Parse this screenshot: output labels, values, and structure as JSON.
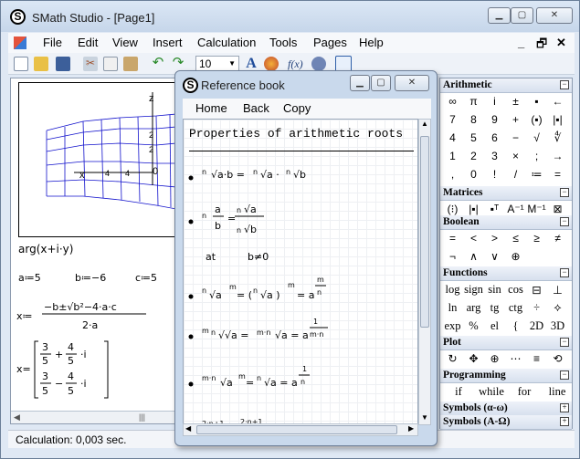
{
  "window": {
    "title": "SMath Studio - [Page1]"
  },
  "menu": [
    "File",
    "Edit",
    "View",
    "Insert",
    "Calculation",
    "Tools",
    "Pages",
    "Help"
  ],
  "toolbar": {
    "font_size": "10"
  },
  "doc": {
    "arg": "arg(x+i·y)",
    "assign": [
      "a≔5",
      "b≔−6",
      "c≔5"
    ],
    "axis_z": "z",
    "axis_x": "x",
    "tick_a": "2",
    "tick_b": "4",
    "tick_c": "4",
    "tick_d": "2",
    "tick_zero": "0"
  },
  "status": "Calculation: 0,003 sec.",
  "ref": {
    "title": "Reference book",
    "menu": [
      "Home",
      "Back",
      "Copy"
    ],
    "heading": "Properties of arithmetic roots",
    "at_label": "at",
    "at_cond": "b≠0"
  },
  "panels": {
    "arithmetic": {
      "title": "Arithmetic",
      "rows": [
        [
          "∞",
          "π",
          "i",
          "±",
          "▪",
          "←"
        ],
        [
          "7",
          "8",
          "9",
          "+",
          "(▪)",
          "|▪|"
        ],
        [
          "4",
          "5",
          "6",
          "−",
          "√",
          "∜"
        ],
        [
          "1",
          "2",
          "3",
          "×",
          ";",
          "→"
        ],
        [
          ",",
          "0",
          "!",
          "/",
          "≔",
          "="
        ]
      ]
    },
    "matrices": {
      "title": "Matrices",
      "rows": [
        [
          "(⁝)",
          "|▪|",
          "▪ᵀ",
          "A⁻¹",
          "M⁻¹",
          "⊠"
        ]
      ]
    },
    "boolean": {
      "title": "Boolean",
      "rows": [
        [
          "=",
          "<",
          ">",
          "≤",
          "≥",
          "≠"
        ],
        [
          "¬",
          "∧",
          "∨",
          "⊕"
        ]
      ]
    },
    "functions": {
      "title": "Functions",
      "rows": [
        [
          "log",
          "sign",
          "sin",
          "cos",
          "⊟",
          "⊥"
        ],
        [
          "ln",
          "arg",
          "tg",
          "ctg",
          "÷",
          "⟡"
        ],
        [
          "exp",
          "%",
          "el",
          "{",
          "2D",
          "3D"
        ]
      ]
    },
    "plot": {
      "title": "Plot",
      "rows": [
        [
          "↻",
          "✥",
          "⊕",
          "⋯",
          "≡",
          "⟲"
        ]
      ]
    },
    "programming": {
      "title": "Programming",
      "rows": [
        [
          "if",
          "while",
          "for",
          "line"
        ]
      ]
    },
    "symbols_lower": {
      "title": "Symbols (α-ω)"
    },
    "symbols_upper": {
      "title": "Symbols (Α-Ω)"
    }
  }
}
